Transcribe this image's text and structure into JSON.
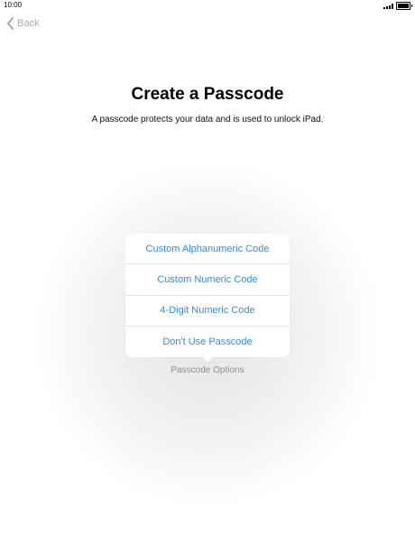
{
  "status_bar": {
    "time": "10:00",
    "signal_icon": "signal-icon",
    "battery_icon": "battery-icon"
  },
  "nav": {
    "back_label": "Back",
    "back_icon": "chevron-left-icon"
  },
  "main": {
    "title": "Create a Passcode",
    "subtitle": "A passcode protects your data and is used to unlock iPad."
  },
  "options_menu": {
    "items": [
      {
        "label": "Custom Alphanumeric Code"
      },
      {
        "label": "Custom Numeric Code"
      },
      {
        "label": "4-Digit Numeric Code"
      },
      {
        "label": "Don't Use Passcode"
      }
    ],
    "toggle_label": "Passcode Options"
  },
  "colors": {
    "accent": "#3a8ad0",
    "muted": "#8e8e93",
    "back": "#a9a9ad"
  }
}
